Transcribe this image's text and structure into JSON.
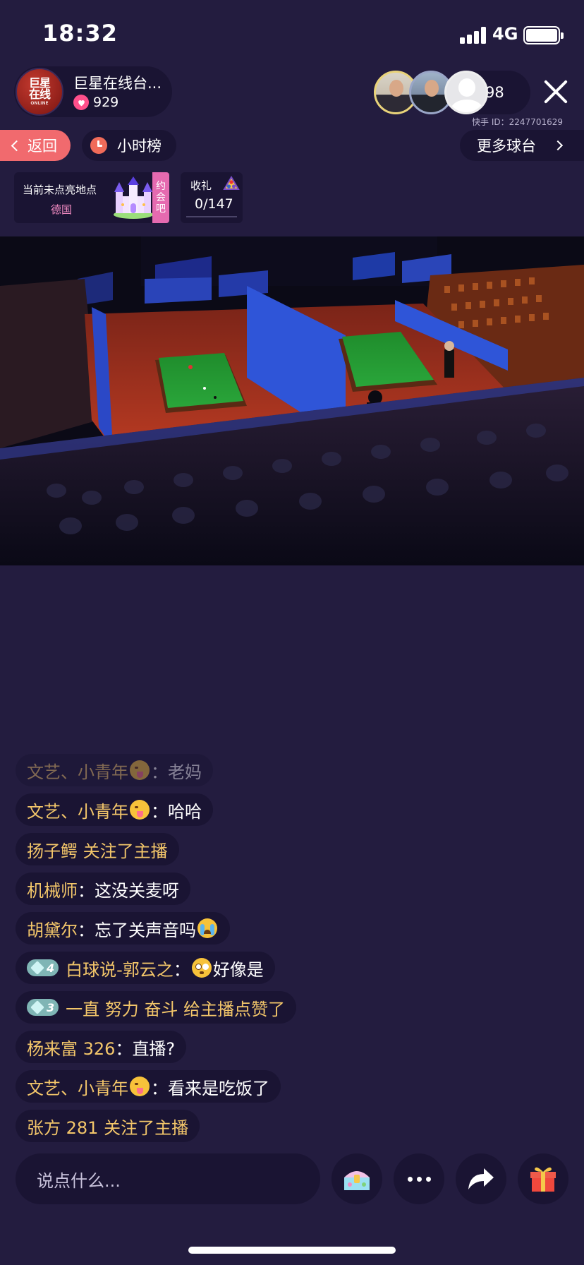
{
  "status_bar": {
    "time": "18:32",
    "network": "4G"
  },
  "host": {
    "name": "巨星在线台...",
    "likes": "929",
    "avatar_text_1": "巨星",
    "avatar_text_2": "在线",
    "avatar_text_3": "ONLINE"
  },
  "viewers": {
    "count": "98"
  },
  "kuaishou_id": "快手 ID：2247701629",
  "nav": {
    "back_label": "返回",
    "hour_rank_label": "小时榜",
    "more_tables_label": "更多球台"
  },
  "location": {
    "label": "当前未点亮地点",
    "place": "德国",
    "yuehui": [
      "约",
      "会",
      "吧"
    ]
  },
  "gift_goal": {
    "label": "收礼",
    "count": "0/147",
    "progress": 0
  },
  "chat": [
    {
      "user": "文艺、小青年",
      "emoji": "tongue",
      "sep": "：",
      "text": "老妈"
    },
    {
      "user": "文艺、小青年",
      "emoji": "tongue",
      "sep": "：",
      "text": "哈哈"
    },
    {
      "user": "扬子鳄 关注了主播"
    },
    {
      "user": "机械师",
      "sep": "：",
      "text": "这没关麦呀"
    },
    {
      "user": "胡黛尔",
      "sep": "：",
      "text": "忘了关声音吗",
      "emoji_after": "crying"
    },
    {
      "level": "4",
      "user": "白球说-郭云之",
      "sep": "：",
      "emoji_pre": "flushed",
      "text": "好像是"
    },
    {
      "level": "3",
      "user": "一直 努力 奋斗 给主播点赞了"
    },
    {
      "user": "杨来富 326",
      "sep": "：",
      "text": "直播?"
    },
    {
      "user": "文艺、小青年",
      "emoji": "tongue",
      "sep": "：",
      "text": "看来是吃饭了"
    },
    {
      "user": "张方 281 关注了主播"
    }
  ],
  "input": {
    "placeholder": "说点什么..."
  },
  "colors": {
    "background": "#231c3f",
    "pill": "#1a1433",
    "username": "#f3c66a",
    "back_button": "#f16a6e",
    "pink": "#e56ab0"
  },
  "icons": [
    "signal-icon",
    "battery-icon",
    "heart-icon",
    "close-icon",
    "chevron-left-icon",
    "clock-icon",
    "chevron-right-icon",
    "castle-icon",
    "cue-ball-icon",
    "treasure-chest-icon",
    "more-dots-icon",
    "share-arrow-icon",
    "gift-icon"
  ]
}
